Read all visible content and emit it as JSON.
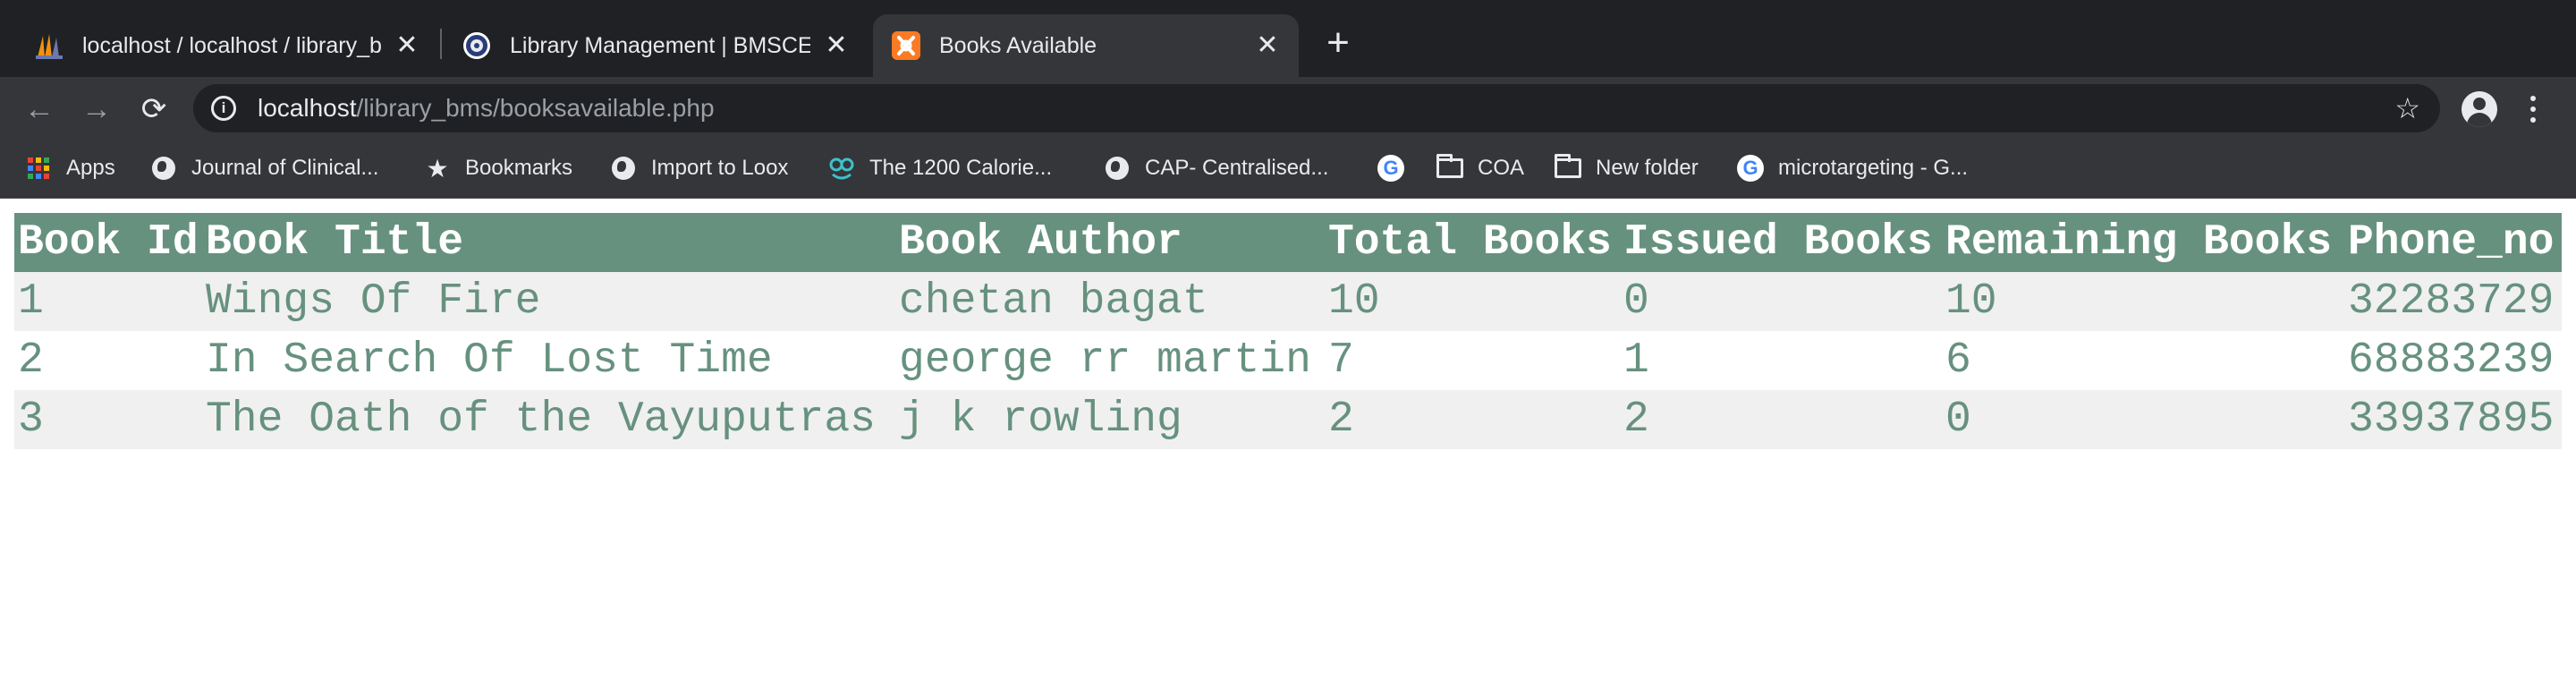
{
  "browser": {
    "tabs": [
      {
        "title": "localhost / localhost / library_b",
        "favicon": "phpmyadmin-icon",
        "active": false
      },
      {
        "title": "Library Management | BMSCE",
        "favicon": "bmsce-logo-icon",
        "active": false
      },
      {
        "title": "Books Available",
        "favicon": "xampp-icon",
        "active": true
      }
    ],
    "new_tab": "+",
    "address": {
      "host": "localhost",
      "path": "/library_bms/booksavailable.php"
    },
    "bookmarks": [
      {
        "label": "Apps",
        "icon": "apps-grid-icon"
      },
      {
        "label": "Journal of Clinical...",
        "icon": "globe-icon"
      },
      {
        "label": "Bookmarks",
        "icon": "star-icon"
      },
      {
        "label": "Import to Loox",
        "icon": "globe-icon"
      },
      {
        "label": "The 1200 Calorie...",
        "icon": "calorie-site-icon"
      },
      {
        "label": "CAP- Centralised...",
        "icon": "globe-icon"
      },
      {
        "label": "",
        "icon": "google-icon"
      },
      {
        "label": "COA",
        "icon": "folder-icon"
      },
      {
        "label": "New folder",
        "icon": "folder-icon"
      },
      {
        "label": "microtargeting - G...",
        "icon": "google-icon"
      }
    ]
  },
  "table": {
    "headers": [
      "Book Id",
      "Book Title",
      "Book Author",
      "Total Books",
      "Issued Books",
      "Remaining Books",
      "Phone_no"
    ],
    "rows": [
      [
        "1",
        "Wings Of Fire",
        "chetan bagat",
        "10",
        "0",
        "10",
        "32283729"
      ],
      [
        "2",
        "In Search Of Lost Time",
        "george rr martin",
        "7",
        "1",
        "6",
        "68883239"
      ],
      [
        "3",
        "The Oath of the Vayuputras",
        "j k rowling",
        "2",
        "2",
        "0",
        "33937895"
      ]
    ]
  },
  "colors": {
    "header_bg": "#67917f",
    "cell_text": "#67917f",
    "striped_row": "#f0f0f0",
    "chrome_dark": "#202124",
    "chrome_toolbar": "#35363a"
  }
}
